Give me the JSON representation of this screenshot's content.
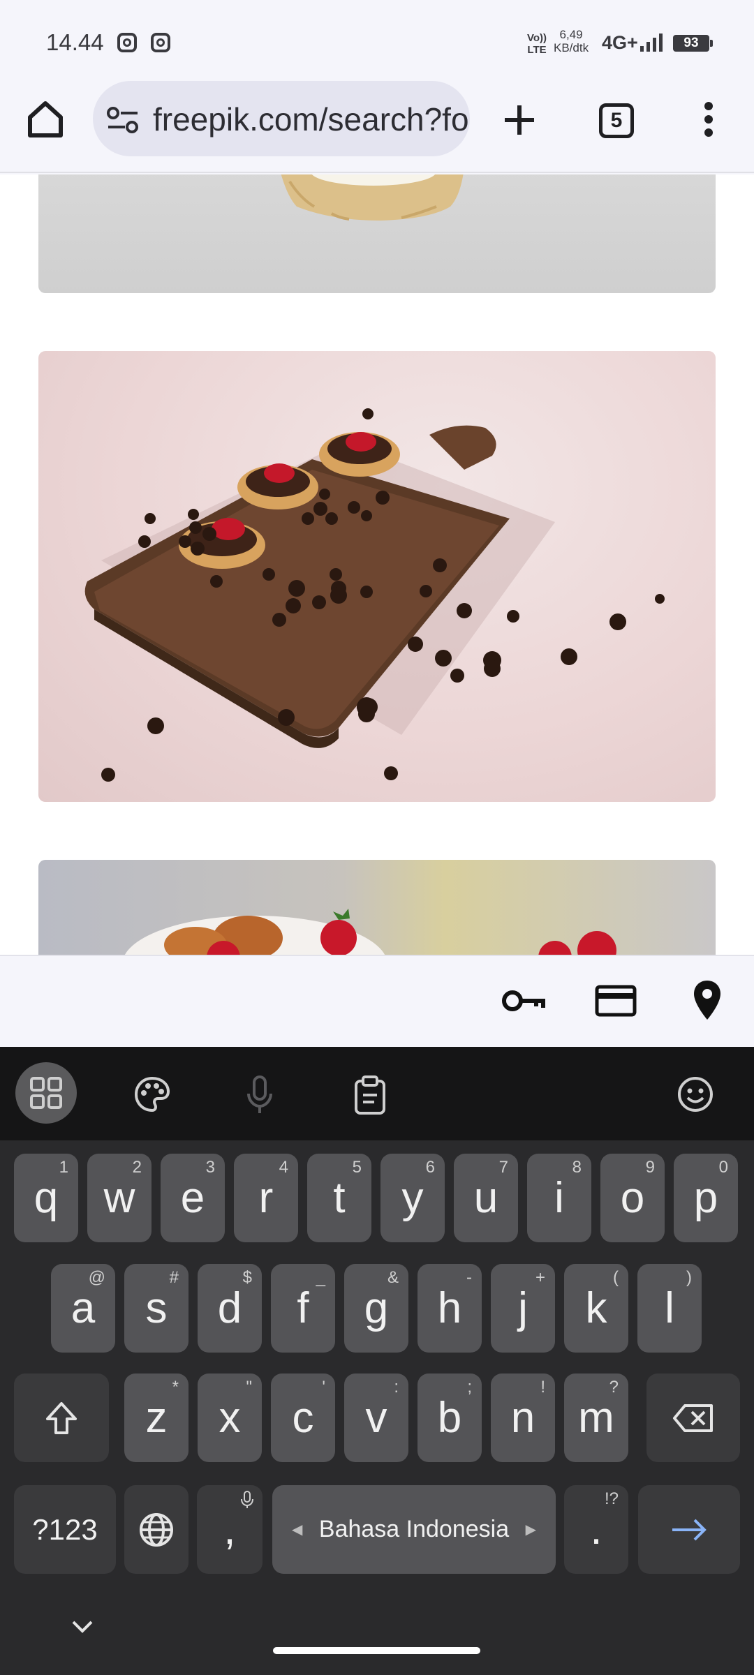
{
  "status_bar": {
    "time": "14.44",
    "volte_line1": "Vo))",
    "volte_line2": "LTE",
    "speed_value": "6,49",
    "speed_unit": "KB/dtk",
    "network": "4G+",
    "battery": "93"
  },
  "browser": {
    "url": "freepik.com/search?format=search&query=",
    "tab_count": "5"
  },
  "keyboard": {
    "row1": [
      {
        "key": "q",
        "hint": "1"
      },
      {
        "key": "w",
        "hint": "2"
      },
      {
        "key": "e",
        "hint": "3"
      },
      {
        "key": "r",
        "hint": "4"
      },
      {
        "key": "t",
        "hint": "5"
      },
      {
        "key": "y",
        "hint": "6"
      },
      {
        "key": "u",
        "hint": "7"
      },
      {
        "key": "i",
        "hint": "8"
      },
      {
        "key": "o",
        "hint": "9"
      },
      {
        "key": "p",
        "hint": "0"
      }
    ],
    "row2": [
      {
        "key": "a",
        "hint": "@"
      },
      {
        "key": "s",
        "hint": "#"
      },
      {
        "key": "d",
        "hint": "$"
      },
      {
        "key": "f",
        "hint": "_"
      },
      {
        "key": "g",
        "hint": "&"
      },
      {
        "key": "h",
        "hint": "-"
      },
      {
        "key": "j",
        "hint": "+"
      },
      {
        "key": "k",
        "hint": "("
      },
      {
        "key": "l",
        "hint": ")"
      }
    ],
    "row3": [
      {
        "key": "z",
        "hint": "*"
      },
      {
        "key": "x",
        "hint": "\""
      },
      {
        "key": "c",
        "hint": "'"
      },
      {
        "key": "v",
        "hint": ":"
      },
      {
        "key": "b",
        "hint": ";"
      },
      {
        "key": "n",
        "hint": "!"
      },
      {
        "key": "m",
        "hint": "?"
      }
    ],
    "symbols_label": "?123",
    "comma": ",",
    "space_label": "Bahasa Indonesia",
    "period": ".",
    "period_hint": "!?"
  },
  "colors": {
    "keyboard_bg": "#2a2a2c",
    "key_bg": "#545457",
    "enter_arrow": "#8ab4f8"
  }
}
